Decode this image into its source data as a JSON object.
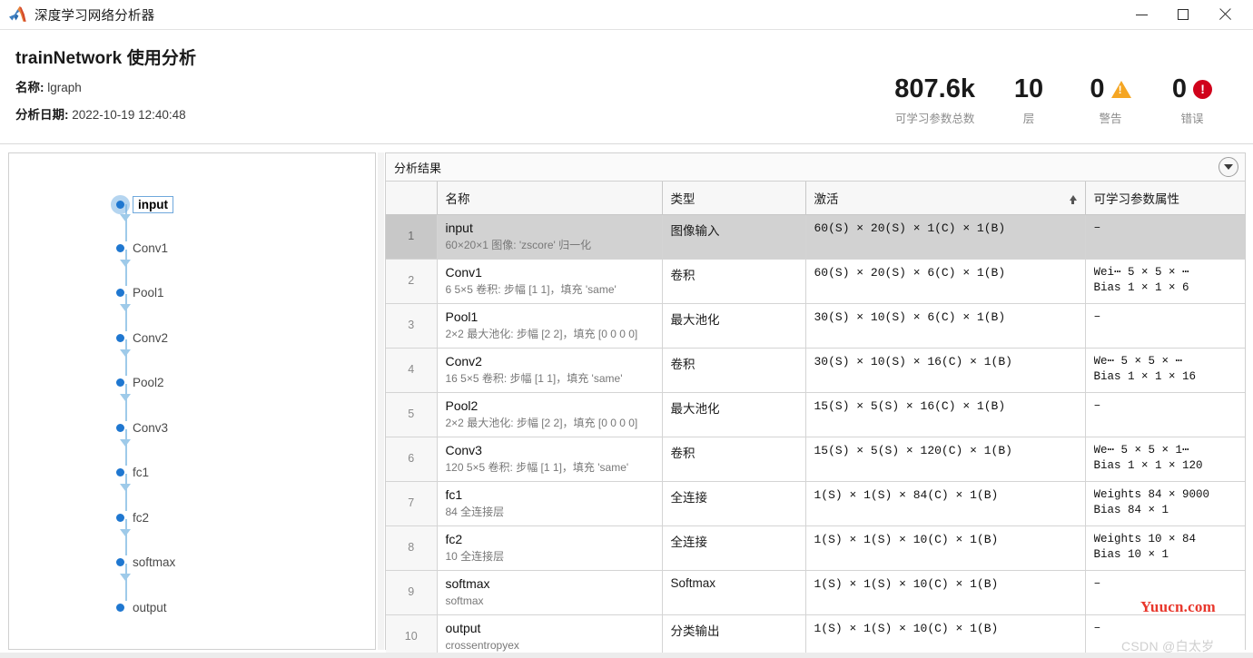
{
  "window": {
    "title": "深度学习网络分析器",
    "logo_icon": "matlab-logo-icon",
    "minimize_label": "最小化",
    "maximize_label": "最大化",
    "close_label": "关闭"
  },
  "header": {
    "title": "trainNetwork 使用分析",
    "name_label": "名称:",
    "name_value": "lgraph",
    "date_label": "分析日期:",
    "date_value": "2022-10-19 12:40:48",
    "stats": [
      {
        "value": "807.6k",
        "caption": "可学习参数总数",
        "icon": ""
      },
      {
        "value": "10",
        "caption": "层",
        "icon": ""
      },
      {
        "value": "0",
        "caption": "警告",
        "icon": "warning-triangle-icon"
      },
      {
        "value": "0",
        "caption": "错误",
        "icon": "error-octagon-icon"
      }
    ]
  },
  "graph": {
    "nodes": [
      {
        "label": "input",
        "selected": true
      },
      {
        "label": "Conv1",
        "selected": false
      },
      {
        "label": "Pool1",
        "selected": false
      },
      {
        "label": "Conv2",
        "selected": false
      },
      {
        "label": "Pool2",
        "selected": false
      },
      {
        "label": "Conv3",
        "selected": false
      },
      {
        "label": "fc1",
        "selected": false
      },
      {
        "label": "fc2",
        "selected": false
      },
      {
        "label": "softmax",
        "selected": false
      },
      {
        "label": "output",
        "selected": false
      }
    ]
  },
  "results": {
    "panel_title": "分析结果",
    "menu_icon": "chevron-down-circle-icon",
    "sort_icon": "sort-ascending-icon",
    "columns": [
      "",
      "名称",
      "类型",
      "激活",
      "可学习参数属性"
    ],
    "rows": [
      {
        "index": "1",
        "selected": true,
        "name": "input",
        "desc": "60×20×1 图像: 'zscore' 归一化",
        "type": "图像输入",
        "activations": "60(S) × 20(S) × 1(C) × 1(B)",
        "learnables": [
          "–"
        ]
      },
      {
        "index": "2",
        "selected": false,
        "name": "Conv1",
        "desc": "6 5×5 卷积: 步幅 [1 1]，填充 'same'",
        "type": "卷积",
        "activations": "60(S) × 20(S) × 6(C) × 1(B)",
        "learnables": [
          "Wei⋯  5 × 5 × ⋯",
          "Bias  1 × 1 × 6"
        ]
      },
      {
        "index": "3",
        "selected": false,
        "name": "Pool1",
        "desc": "2×2 最大池化: 步幅 [2 2]，填充 [0 0 0 0]",
        "type": "最大池化",
        "activations": "30(S) × 10(S) × 6(C) × 1(B)",
        "learnables": [
          "–"
        ]
      },
      {
        "index": "4",
        "selected": false,
        "name": "Conv2",
        "desc": "16 5×5 卷积: 步幅 [1 1]，填充 'same'",
        "type": "卷积",
        "activations": "30(S) × 10(S) × 16(C) × 1(B)",
        "learnables": [
          "We⋯  5 × 5 × ⋯",
          "Bias  1 × 1 × 16"
        ]
      },
      {
        "index": "5",
        "selected": false,
        "name": "Pool2",
        "desc": "2×2 最大池化: 步幅 [2 2]，填充 [0 0 0 0]",
        "type": "最大池化",
        "activations": "15(S) × 5(S) × 16(C) × 1(B)",
        "learnables": [
          "–"
        ]
      },
      {
        "index": "6",
        "selected": false,
        "name": "Conv3",
        "desc": "120 5×5 卷积: 步幅 [1 1]，填充 'same'",
        "type": "卷积",
        "activations": "15(S) × 5(S) × 120(C) × 1(B)",
        "learnables": [
          "We⋯  5 × 5 × 1⋯",
          "Bias  1 × 1 × 120"
        ]
      },
      {
        "index": "7",
        "selected": false,
        "name": "fc1",
        "desc": "84 全连接层",
        "type": "全连接",
        "activations": "1(S) × 1(S) × 84(C) × 1(B)",
        "learnables": [
          "Weights 84 × 9000",
          "Bias    84 × 1"
        ]
      },
      {
        "index": "8",
        "selected": false,
        "name": "fc2",
        "desc": "10 全连接层",
        "type": "全连接",
        "activations": "1(S) × 1(S) × 10(C) × 1(B)",
        "learnables": [
          "Weights 10 × 84",
          "Bias    10 × 1"
        ]
      },
      {
        "index": "9",
        "selected": false,
        "name": "softmax",
        "desc": "softmax",
        "type": "Softmax",
        "activations": "1(S) × 1(S) × 10(C) × 1(B)",
        "learnables": [
          "–"
        ]
      },
      {
        "index": "10",
        "selected": false,
        "name": "output",
        "desc": "crossentropyex",
        "type": "分类输出",
        "activations": "1(S) × 1(S) × 10(C) × 1(B)",
        "learnables": [
          "–"
        ]
      }
    ]
  },
  "watermarks": {
    "yuucn": "Yuucn.com",
    "csdn": "CSDN @白太岁"
  },
  "colors": {
    "accent_blue": "#1f77d0",
    "edge_blue": "#9ecae9",
    "warning": "#f5a623",
    "error": "#d0021b",
    "watermark_red": "#e8372c"
  }
}
